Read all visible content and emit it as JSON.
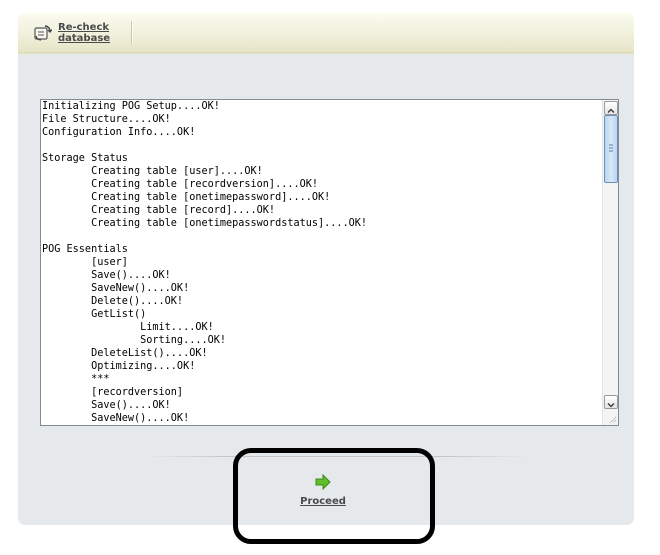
{
  "toolbar": {
    "recheck_label": "Re-check\ndatabase",
    "recheck_icon": "refresh-database-icon"
  },
  "log": {
    "lines": [
      "Initializing POG Setup....OK!",
      "File Structure....OK!",
      "Configuration Info....OK!",
      "",
      "Storage Status",
      "        Creating table [user]....OK!",
      "        Creating table [recordversion]....OK!",
      "        Creating table [onetimepassword]....OK!",
      "        Creating table [record]....OK!",
      "        Creating table [onetimepasswordstatus]....OK!",
      "",
      "POG Essentials",
      "        [user]",
      "        Save()....OK!",
      "        SaveNew()....OK!",
      "        Delete()....OK!",
      "        GetList()",
      "                Limit....OK!",
      "                Sorting....OK!",
      "        DeleteList()....OK!",
      "        Optimizing....OK!",
      "        ***",
      "        [recordversion]",
      "        Save()....OK!",
      "        SaveNew()....OK!"
    ]
  },
  "footer": {
    "proceed_label": "Proceed",
    "proceed_icon": "arrow-right-icon",
    "proceed_icon_color": "#5fbf2a",
    "highlight_color": "#000000"
  }
}
